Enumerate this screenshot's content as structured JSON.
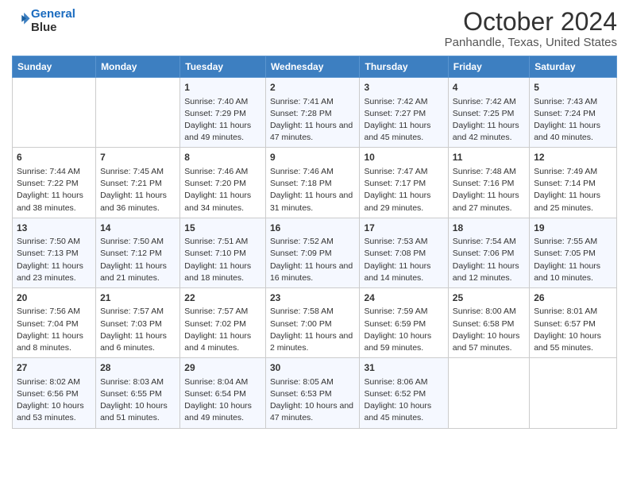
{
  "header": {
    "logo_line1": "General",
    "logo_line2": "Blue",
    "title": "October 2024",
    "subtitle": "Panhandle, Texas, United States"
  },
  "calendar": {
    "days_of_week": [
      "Sunday",
      "Monday",
      "Tuesday",
      "Wednesday",
      "Thursday",
      "Friday",
      "Saturday"
    ],
    "weeks": [
      [
        {
          "day": "",
          "content": ""
        },
        {
          "day": "",
          "content": ""
        },
        {
          "day": "1",
          "content": "Sunrise: 7:40 AM\nSunset: 7:29 PM\nDaylight: 11 hours and 49 minutes."
        },
        {
          "day": "2",
          "content": "Sunrise: 7:41 AM\nSunset: 7:28 PM\nDaylight: 11 hours and 47 minutes."
        },
        {
          "day": "3",
          "content": "Sunrise: 7:42 AM\nSunset: 7:27 PM\nDaylight: 11 hours and 45 minutes."
        },
        {
          "day": "4",
          "content": "Sunrise: 7:42 AM\nSunset: 7:25 PM\nDaylight: 11 hours and 42 minutes."
        },
        {
          "day": "5",
          "content": "Sunrise: 7:43 AM\nSunset: 7:24 PM\nDaylight: 11 hours and 40 minutes."
        }
      ],
      [
        {
          "day": "6",
          "content": "Sunrise: 7:44 AM\nSunset: 7:22 PM\nDaylight: 11 hours and 38 minutes."
        },
        {
          "day": "7",
          "content": "Sunrise: 7:45 AM\nSunset: 7:21 PM\nDaylight: 11 hours and 36 minutes."
        },
        {
          "day": "8",
          "content": "Sunrise: 7:46 AM\nSunset: 7:20 PM\nDaylight: 11 hours and 34 minutes."
        },
        {
          "day": "9",
          "content": "Sunrise: 7:46 AM\nSunset: 7:18 PM\nDaylight: 11 hours and 31 minutes."
        },
        {
          "day": "10",
          "content": "Sunrise: 7:47 AM\nSunset: 7:17 PM\nDaylight: 11 hours and 29 minutes."
        },
        {
          "day": "11",
          "content": "Sunrise: 7:48 AM\nSunset: 7:16 PM\nDaylight: 11 hours and 27 minutes."
        },
        {
          "day": "12",
          "content": "Sunrise: 7:49 AM\nSunset: 7:14 PM\nDaylight: 11 hours and 25 minutes."
        }
      ],
      [
        {
          "day": "13",
          "content": "Sunrise: 7:50 AM\nSunset: 7:13 PM\nDaylight: 11 hours and 23 minutes."
        },
        {
          "day": "14",
          "content": "Sunrise: 7:50 AM\nSunset: 7:12 PM\nDaylight: 11 hours and 21 minutes."
        },
        {
          "day": "15",
          "content": "Sunrise: 7:51 AM\nSunset: 7:10 PM\nDaylight: 11 hours and 18 minutes."
        },
        {
          "day": "16",
          "content": "Sunrise: 7:52 AM\nSunset: 7:09 PM\nDaylight: 11 hours and 16 minutes."
        },
        {
          "day": "17",
          "content": "Sunrise: 7:53 AM\nSunset: 7:08 PM\nDaylight: 11 hours and 14 minutes."
        },
        {
          "day": "18",
          "content": "Sunrise: 7:54 AM\nSunset: 7:06 PM\nDaylight: 11 hours and 12 minutes."
        },
        {
          "day": "19",
          "content": "Sunrise: 7:55 AM\nSunset: 7:05 PM\nDaylight: 11 hours and 10 minutes."
        }
      ],
      [
        {
          "day": "20",
          "content": "Sunrise: 7:56 AM\nSunset: 7:04 PM\nDaylight: 11 hours and 8 minutes."
        },
        {
          "day": "21",
          "content": "Sunrise: 7:57 AM\nSunset: 7:03 PM\nDaylight: 11 hours and 6 minutes."
        },
        {
          "day": "22",
          "content": "Sunrise: 7:57 AM\nSunset: 7:02 PM\nDaylight: 11 hours and 4 minutes."
        },
        {
          "day": "23",
          "content": "Sunrise: 7:58 AM\nSunset: 7:00 PM\nDaylight: 11 hours and 2 minutes."
        },
        {
          "day": "24",
          "content": "Sunrise: 7:59 AM\nSunset: 6:59 PM\nDaylight: 10 hours and 59 minutes."
        },
        {
          "day": "25",
          "content": "Sunrise: 8:00 AM\nSunset: 6:58 PM\nDaylight: 10 hours and 57 minutes."
        },
        {
          "day": "26",
          "content": "Sunrise: 8:01 AM\nSunset: 6:57 PM\nDaylight: 10 hours and 55 minutes."
        }
      ],
      [
        {
          "day": "27",
          "content": "Sunrise: 8:02 AM\nSunset: 6:56 PM\nDaylight: 10 hours and 53 minutes."
        },
        {
          "day": "28",
          "content": "Sunrise: 8:03 AM\nSunset: 6:55 PM\nDaylight: 10 hours and 51 minutes."
        },
        {
          "day": "29",
          "content": "Sunrise: 8:04 AM\nSunset: 6:54 PM\nDaylight: 10 hours and 49 minutes."
        },
        {
          "day": "30",
          "content": "Sunrise: 8:05 AM\nSunset: 6:53 PM\nDaylight: 10 hours and 47 minutes."
        },
        {
          "day": "31",
          "content": "Sunrise: 8:06 AM\nSunset: 6:52 PM\nDaylight: 10 hours and 45 minutes."
        },
        {
          "day": "",
          "content": ""
        },
        {
          "day": "",
          "content": ""
        }
      ]
    ]
  }
}
